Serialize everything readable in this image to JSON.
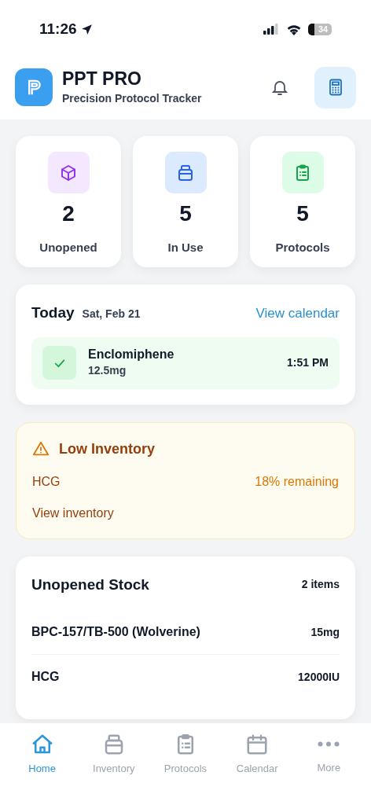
{
  "status_bar": {
    "time": "11:26",
    "battery": "34"
  },
  "header": {
    "title": "PPT PRO",
    "subtitle": "Precision Protocol Tracker"
  },
  "stats": [
    {
      "kind": "box",
      "value": "2",
      "label": "Unopened"
    },
    {
      "kind": "jar",
      "value": "5",
      "label": "In Use"
    },
    {
      "kind": "clipboard",
      "value": "5",
      "label": "Protocols"
    }
  ],
  "today": {
    "title": "Today",
    "date": "Sat, Feb 21",
    "link": "View calendar",
    "doses": [
      {
        "name": "Enclomiphene",
        "amount": "12.5mg",
        "time": "1:51 PM",
        "checked": true
      }
    ]
  },
  "low_inventory": {
    "title": "Low Inventory",
    "items": [
      {
        "name": "HCG",
        "remaining": "18% remaining"
      }
    ],
    "link": "View inventory"
  },
  "unopened_stock": {
    "title": "Unopened Stock",
    "count": "2 items",
    "items": [
      {
        "name": "BPC-157/TB-500 (Wolverine)",
        "amount": "15mg"
      },
      {
        "name": "HCG",
        "amount": "12000IU"
      }
    ]
  },
  "tab_bar": [
    {
      "kind": "home",
      "label": "Home",
      "selected": true
    },
    {
      "kind": "jar",
      "label": "Inventory",
      "selected": false
    },
    {
      "kind": "clipboard",
      "label": "Protocols",
      "selected": false
    },
    {
      "kind": "calendar",
      "label": "Calendar",
      "selected": false
    },
    {
      "kind": "more",
      "label": "More",
      "selected": false
    }
  ]
}
